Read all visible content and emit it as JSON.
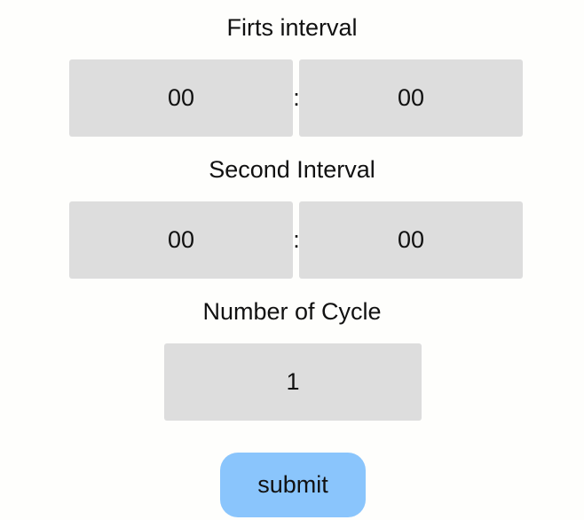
{
  "first_interval": {
    "label": "Firts interval",
    "minutes": "00",
    "separator": ":",
    "seconds": "00"
  },
  "second_interval": {
    "label": "Second Interval",
    "minutes": "00",
    "separator": ":",
    "seconds": "00"
  },
  "cycles": {
    "label": "Number of Cycle",
    "value": "1"
  },
  "submit": {
    "label": "submit"
  },
  "colors": {
    "background": "#fefefc",
    "field": "#dddddd",
    "submit": "#8ac5fc"
  }
}
